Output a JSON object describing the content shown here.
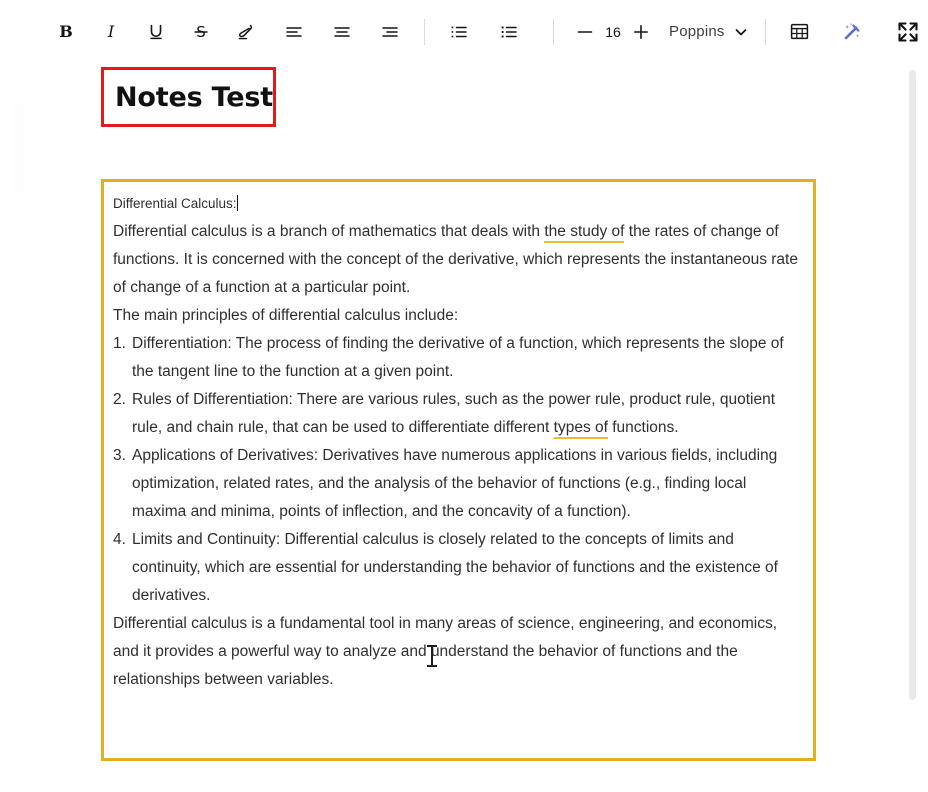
{
  "toolbar": {
    "bold": {
      "label": "B",
      "name": "bold-icon"
    },
    "italic": {
      "label": "I",
      "name": "italic-icon"
    },
    "underline": {
      "label": "U",
      "name": "underline-icon"
    },
    "strikethrough": {
      "label": "S",
      "name": "strikethrough-icon"
    },
    "highlight": {
      "label": "highlighter-icon"
    },
    "align_left": {
      "label": "align-left-icon"
    },
    "align_center": {
      "label": "align-center-icon"
    },
    "align_right": {
      "label": "align-right-icon"
    },
    "ordered_list": {
      "label": "ordered-list-icon"
    },
    "bullet_list": {
      "label": "bullet-list-icon"
    },
    "font_size_decrease": "—",
    "font_size_value": "16",
    "font_size_increase": "+",
    "font_family_value": "Poppins",
    "font_family_caret": "chevron-down-icon",
    "table": {
      "label": "table-icon"
    },
    "magic": {
      "label": "magic-wand-icon"
    },
    "fullscreen": {
      "label": "fullscreen-icon"
    }
  },
  "note": {
    "title": "Notes Test"
  },
  "document": {
    "lead_line": "Differential Calculus:",
    "paragraphs": [
      {
        "type": "paragraph",
        "segments": [
          {
            "text": "Differential calculus is a branch of mathematics that deals with "
          },
          {
            "text": "the study of",
            "underline_color": "#e8bb3c"
          },
          {
            "text": " the rates of change of functions. It is concerned with the concept of the derivative, which represents the instantaneous rate of change of a function at a particular point."
          }
        ]
      },
      {
        "type": "paragraph",
        "segments": [
          {
            "text": "The main principles of differential calculus include:"
          }
        ]
      }
    ],
    "list_items": [
      {
        "marker": "1.",
        "segments": [
          {
            "text": "Differentiation: The process of finding the derivative of a function, which represents the slope of the tangent line to the function at a given point."
          }
        ]
      },
      {
        "marker": "2.",
        "segments": [
          {
            "text": "Rules of Differentiation: There are various rules, such as the power rule, product rule, quotient rule, and chain rule, that can be used to differentiate different "
          },
          {
            "text": "types of",
            "underline_color": "#e8bb3c"
          },
          {
            "text": " functions."
          }
        ]
      },
      {
        "marker": "3.",
        "segments": [
          {
            "text": "Applications of Derivatives: Derivatives have numerous applications in various fields, including optimization, related rates, and the analysis of the behavior of functions (e.g., finding local maxima and minima, points of inflection, and the concavity of a function)."
          }
        ]
      },
      {
        "marker": "4.",
        "segments": [
          {
            "text": "Limits and Continuity: Differential calculus is closely related to the concepts of limits and continuity, which are essential for understanding the behavior of functions and the existence of derivatives."
          }
        ]
      }
    ],
    "closing_paragraph": "Differential calculus is a fundamental tool in many areas of science, engineering, and economics, and it provides a powerful way to analyze and understand the behavior of functions and the relationships between variables."
  },
  "colors": {
    "title_border": "#e11b1b",
    "editor_border": "#e3ae25",
    "underline_gold": "#e8bb3c",
    "magic_icon": "#5a6fd0",
    "text": "#2f2f2f"
  }
}
